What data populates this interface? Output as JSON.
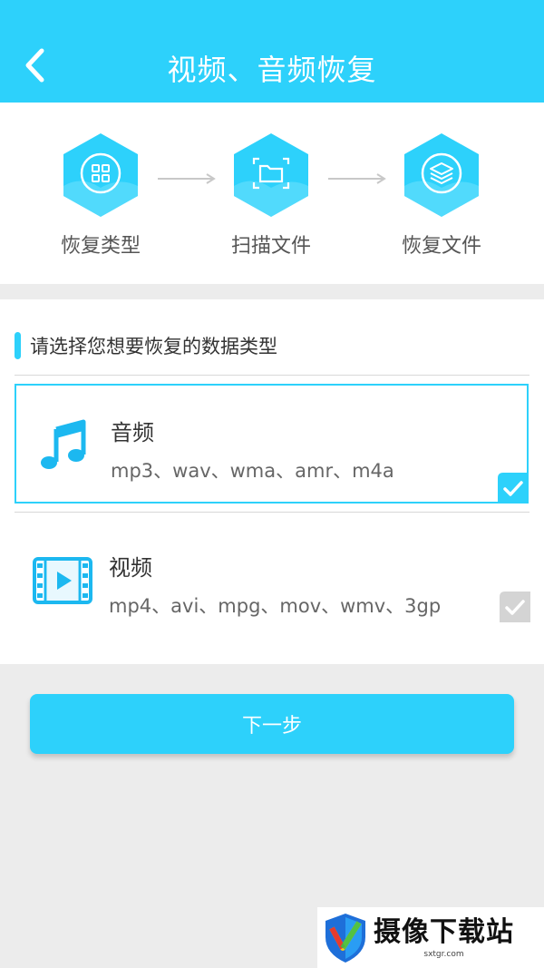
{
  "header": {
    "title": "视频、音频恢复",
    "background": "#2dd1fb"
  },
  "steps": [
    {
      "label": "恢复类型",
      "icon": "grid-icon"
    },
    {
      "label": "扫描文件",
      "icon": "folder-scan-icon"
    },
    {
      "label": "恢复文件",
      "icon": "layers-icon"
    }
  ],
  "prompt": "请选择您想要恢复的数据类型",
  "options": [
    {
      "name": "音频",
      "formats": "mp3、wav、wma、amr、m4a",
      "icon": "music-note-icon",
      "selected": true
    },
    {
      "name": "视频",
      "formats": "mp4、avi、mpg、mov、wmv、3gp",
      "icon": "film-icon",
      "selected": false
    }
  ],
  "next_button": "下一步",
  "watermark": {
    "name": "摄像下载站",
    "url": "sxtgr.com"
  },
  "colors": {
    "accent": "#2dd1fb",
    "unchecked": "#d4d4d4"
  }
}
